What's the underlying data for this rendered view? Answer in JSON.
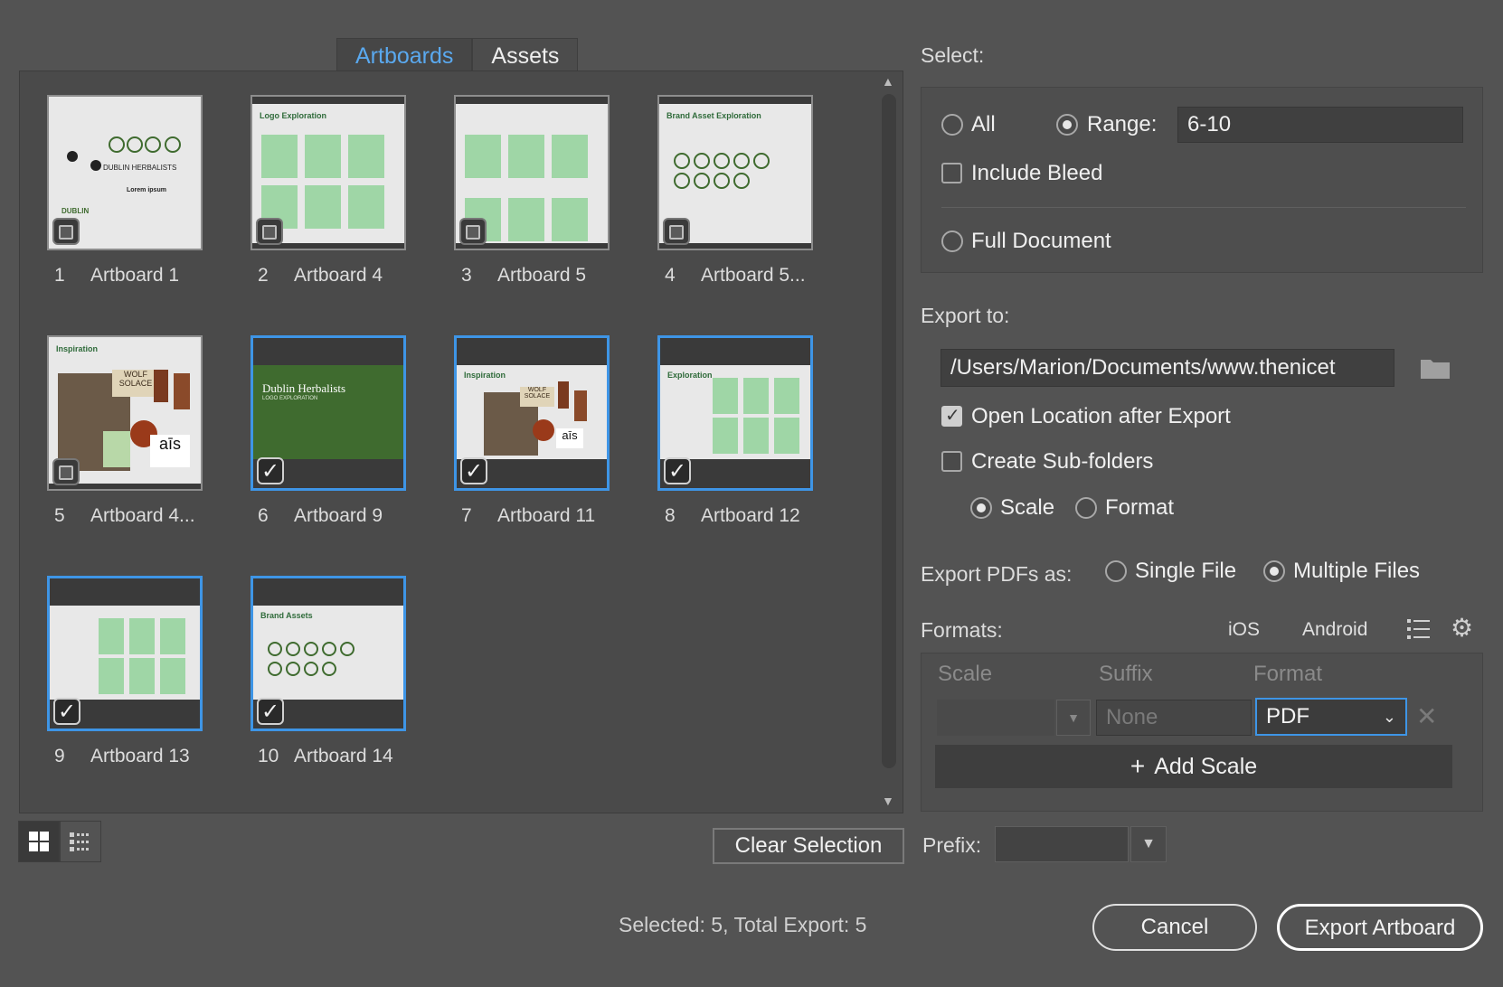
{
  "tabs": {
    "artboards": "Artboards",
    "assets": "Assets"
  },
  "artboards": [
    {
      "num": "1",
      "name": "Artboard 1",
      "selected": false,
      "title": ""
    },
    {
      "num": "2",
      "name": "Artboard 4",
      "selected": false,
      "title": "Logo Exploration"
    },
    {
      "num": "3",
      "name": "Artboard 5",
      "selected": false,
      "title": ""
    },
    {
      "num": "4",
      "name": "Artboard 5...",
      "selected": false,
      "title": "Brand Asset Exploration"
    },
    {
      "num": "5",
      "name": "Artboard 4...",
      "selected": false,
      "title": "Inspiration"
    },
    {
      "num": "6",
      "name": "Artboard 9",
      "selected": true,
      "title": "Dublin Herbalists"
    },
    {
      "num": "7",
      "name": "Artboard 11",
      "selected": true,
      "title": "Inspiration"
    },
    {
      "num": "8",
      "name": "Artboard 12",
      "selected": true,
      "title": "Exploration"
    },
    {
      "num": "9",
      "name": "Artboard 13",
      "selected": true,
      "title": ""
    },
    {
      "num": "10",
      "name": "Artboard 14",
      "selected": true,
      "title": "Brand Assets"
    }
  ],
  "thumb_text": {
    "dublin_sub": "LOGO EXPLORATION",
    "dublin_herbalists": "DUBLIN HERBALISTS",
    "lorem": "Lorem ipsum",
    "dublin": "DUBLIN",
    "wolf": "WOLF SOLACE",
    "ais": "aīs"
  },
  "buttons": {
    "clear_selection": "Clear Selection",
    "cancel": "Cancel",
    "export": "Export Artboard"
  },
  "status": "Selected: 5, Total Export: 5",
  "select": {
    "heading": "Select:",
    "all": "All",
    "range_label": "Range:",
    "range_value": "6-10",
    "include_bleed": "Include Bleed",
    "full_document": "Full Document"
  },
  "export_to": {
    "heading": "Export to:",
    "path": "/Users/Marion/Documents/www.thenicet",
    "open_location": "Open Location after Export",
    "create_subfolders": "Create Sub-folders",
    "scale": "Scale",
    "format": "Format"
  },
  "pdf_as": {
    "label": "Export PDFs as:",
    "single": "Single File",
    "multiple": "Multiple Files"
  },
  "formats": {
    "heading": "Formats:",
    "ios": "iOS",
    "android": "Android",
    "col_scale": "Scale",
    "col_suffix": "Suffix",
    "col_format": "Format",
    "suffix_placeholder": "None",
    "format_value": "PDF",
    "add_scale": "Add Scale"
  },
  "prefix_label": "Prefix:",
  "colors": {
    "accent": "#3e95e6",
    "thumb_green": "#9fd6a6",
    "dark_green": "#3f6b2f"
  }
}
